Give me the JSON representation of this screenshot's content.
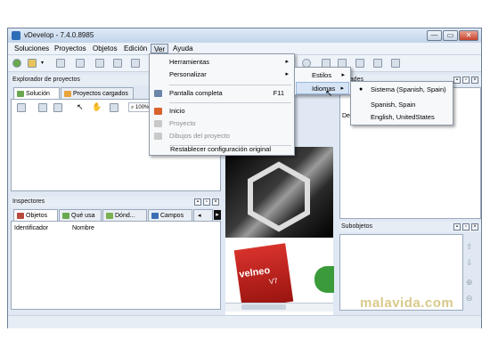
{
  "window": {
    "title": "vDevelop - 7.4.0.8985",
    "minimize": "—",
    "maximize": "▭",
    "close": "✕"
  },
  "menubar": [
    "Soluciones",
    "Proyectos",
    "Objetos",
    "Edición",
    "Ver",
    "Ayuda"
  ],
  "explorer": {
    "title": "Explorador de proyectos",
    "tabs": [
      "Solución",
      "Proyectos cargados"
    ],
    "zoom": "100%"
  },
  "inspectors": {
    "title": "Inspectores",
    "tabs": [
      "Objetos",
      "Qué usa",
      "Dónd...",
      "Campos"
    ],
    "columns": [
      "Identificador",
      "Nombre"
    ]
  },
  "properties": {
    "title": "edades",
    "tab": "Des"
  },
  "subobjects": {
    "title": "Subobjetos"
  },
  "ver_menu": {
    "items": [
      {
        "label": "Herramientas",
        "submenu": true
      },
      {
        "label": "Personalizar",
        "submenu": true
      },
      {
        "label": "Pantalla completa",
        "shortcut": "F11"
      },
      {
        "label": "Inicio"
      },
      {
        "label": "Proyecto",
        "disabled": true
      },
      {
        "label": "Dibujos del proyecto",
        "disabled": true
      },
      {
        "label": "Restablecer configuración original"
      }
    ]
  },
  "personalizar_menu": {
    "items": [
      "Estilos",
      "Idiomas"
    ]
  },
  "idiomas_menu": {
    "items": [
      {
        "label": "Sistema (Spanish, Spain)",
        "selected": true
      },
      {
        "label": "Spanish, Spain"
      },
      {
        "label": "English, UnitedStates"
      }
    ]
  },
  "brand": {
    "logo_text": "velneo",
    "logo_version": "V7"
  },
  "watermark": "malavida.com",
  "colors": {
    "accent": "#2c6db8",
    "menu_highlight": "#d6e4f5",
    "logo_red": "#c8201f",
    "watermark": "#d9c98a"
  }
}
